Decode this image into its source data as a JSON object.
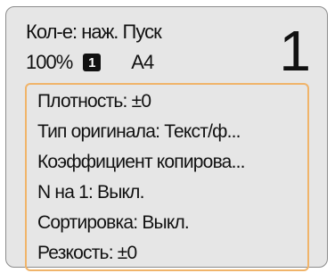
{
  "status": {
    "message": "Кол-е: наж. Пуск",
    "zoom": "100%",
    "tray_number": "1",
    "paper_size": "A4",
    "copies": "1"
  },
  "settings": [
    {
      "label": "Плотность:  ±0"
    },
    {
      "label": "Тип оригинала: Текст/ф..."
    },
    {
      "label": "Коэффициент копирова..."
    },
    {
      "label": "N на 1: Выкл."
    },
    {
      "label": "Сортировка: Выкл."
    },
    {
      "label": "Резкость:  ±0"
    }
  ],
  "colors": {
    "highlight_border": "#f0b46a",
    "screen_background": "#e6e6e6"
  }
}
